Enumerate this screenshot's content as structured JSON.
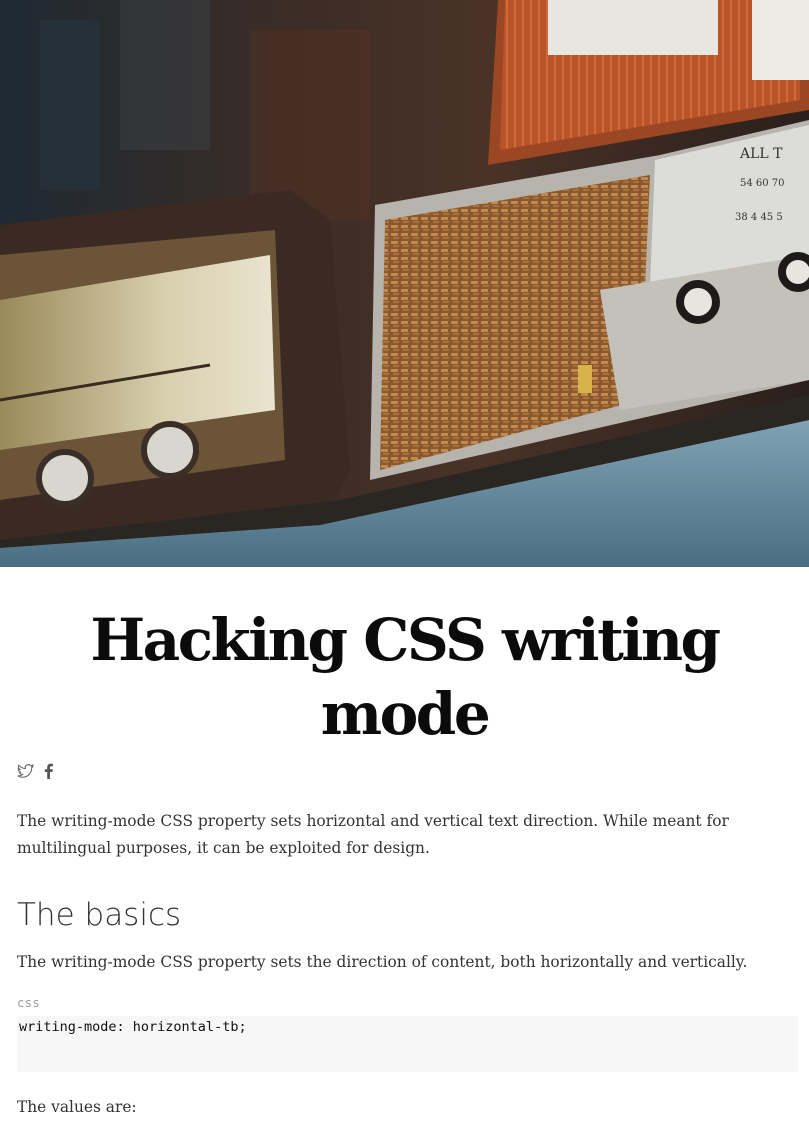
{
  "hero": {
    "image": "vintage-radios-photo"
  },
  "article": {
    "title": "Hacking CSS writing mode",
    "share": {
      "icons": [
        "twitter-icon",
        "facebook-icon"
      ]
    },
    "intro": "The writing-mode CSS property sets horizontal and vertical text direction. While meant for multilingual purposes, it can be exploited for design.",
    "section_heading": "The basics",
    "section_text": "The writing-mode CSS property sets the direction of content, both horizontally and vertically.",
    "code": {
      "language": "css",
      "content": "writing-mode: horizontal-tb;"
    },
    "values_intro": "The values are:"
  },
  "colors": {
    "text": "#333333",
    "title": "#0b0b0b",
    "code_bg": "#f7f7f7",
    "code_label": "#9a9a9a"
  }
}
